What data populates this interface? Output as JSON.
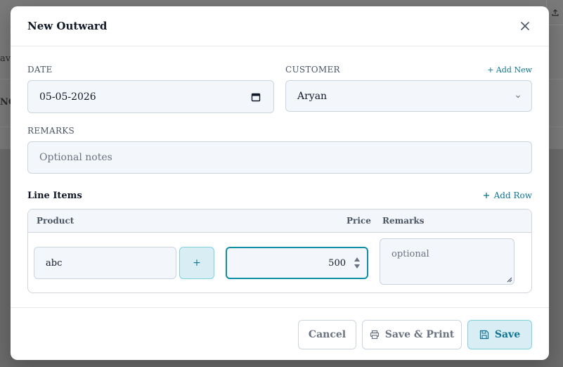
{
  "background": {
    "text_fragment_1": "avo",
    "text_fragment_2": "NO",
    "top_icon": "upload-icon"
  },
  "modal": {
    "title": "New Outward",
    "close_icon": "close-icon"
  },
  "form": {
    "date": {
      "label": "DATE",
      "value": "05-05-2026",
      "icon": "calendar-icon"
    },
    "customer": {
      "label": "CUSTOMER",
      "value": "Aryan",
      "add_new_label": "+ Add New",
      "icon": "chevron-down-icon"
    },
    "remarks": {
      "label": "REMARKS",
      "placeholder": "Optional notes"
    }
  },
  "line_items": {
    "title": "Line Items",
    "add_row_label": "Add Row",
    "columns": {
      "product": "Product",
      "price": "Price",
      "remarks": "Remarks"
    },
    "rows": [
      {
        "product": "abc",
        "add_product_label": "+",
        "price": "500",
        "remarks_placeholder": "optional"
      }
    ]
  },
  "footer": {
    "cancel_label": "Cancel",
    "save_print_label": "Save & Print",
    "save_label": "Save"
  },
  "colors": {
    "accent": "#0e7490",
    "accent_light": "#d9eef4",
    "focus_border": "#0e8fa6"
  }
}
